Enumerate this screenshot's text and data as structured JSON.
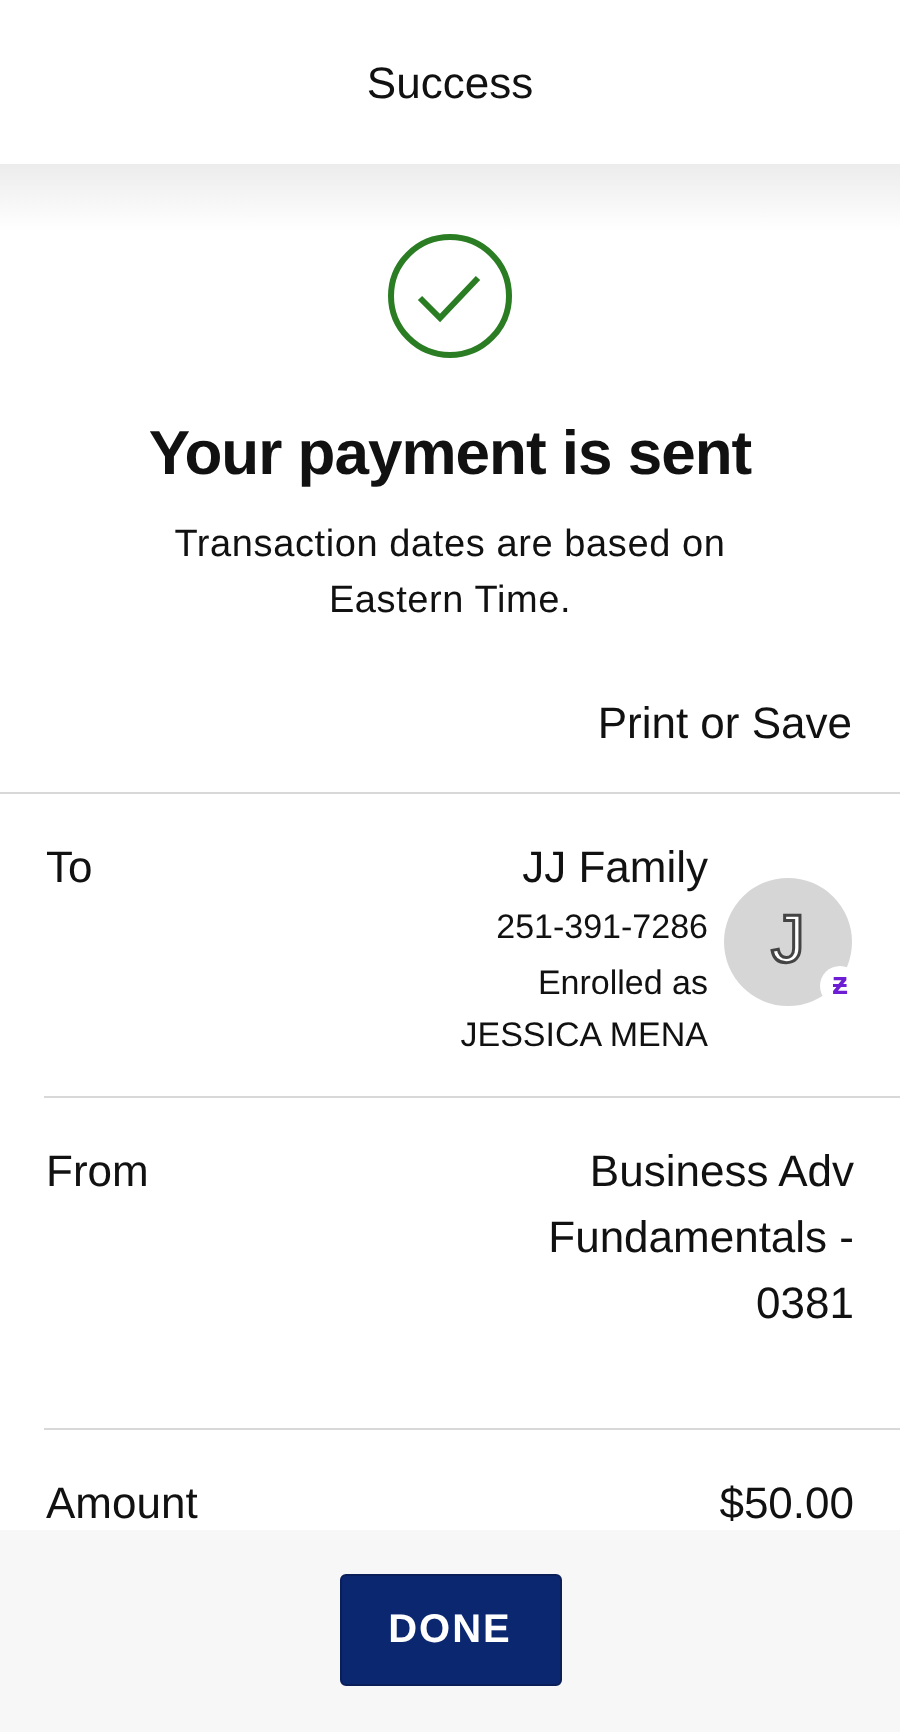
{
  "header": {
    "title": "Success"
  },
  "status": {
    "kind": "success",
    "title": "Your payment is sent",
    "note": "Transaction dates are based on Eastern Time."
  },
  "print_link": "Print or Save",
  "details": [
    {
      "kind": "payee",
      "label": "To",
      "name": "JJ Family",
      "phone": "251-391-7286",
      "enrolled": "Enrolled as",
      "enrolled_name": "JESSICA MENA",
      "avatar_letter": "J",
      "avatar_badge": "ƶ"
    },
    {
      "kind": "account",
      "label": "From",
      "value": "Business Adv Fundamentals - 0381"
    },
    {
      "kind": "amount",
      "label": "Amount",
      "value": "$50.00"
    }
  ],
  "done_button": "DONE"
}
